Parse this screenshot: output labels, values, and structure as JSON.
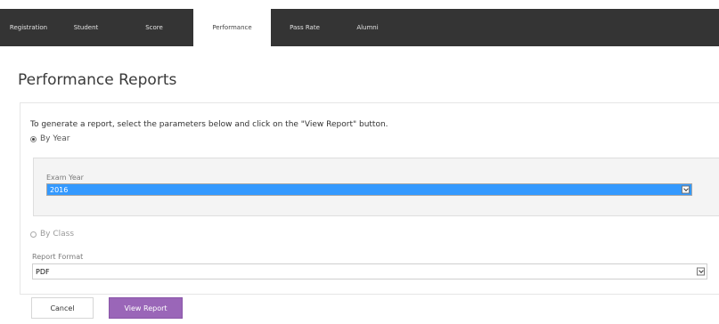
{
  "nav": {
    "tabs": [
      {
        "label": "Registration"
      },
      {
        "label": "Student"
      },
      {
        "label": "Score"
      },
      {
        "label": "Performance"
      },
      {
        "label": "Pass Rate"
      },
      {
        "label": "Alumni"
      }
    ],
    "active_tab": "Performance"
  },
  "page": {
    "title": "Performance Reports",
    "instruction": "To generate a report, select the parameters below and click on the \"View Report\" button."
  },
  "filters": {
    "by_year_label": "By Year",
    "by_year_selected": true,
    "exam_year_label": "Exam Year",
    "exam_year_value": "2016",
    "by_class_label": "By Class",
    "by_class_selected": false
  },
  "format": {
    "label": "Report Format",
    "value": "PDF"
  },
  "actions": {
    "cancel_label": "Cancel",
    "view_report_label": "View Report"
  },
  "colors": {
    "nav_bg": "#343434",
    "primary_button": "#9a66b8",
    "selection": "#3399ff"
  }
}
